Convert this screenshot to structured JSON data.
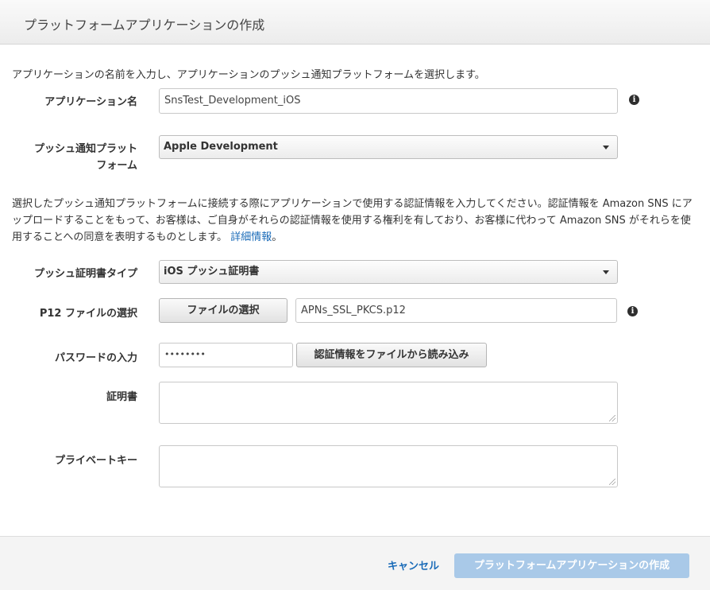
{
  "dialog": {
    "title": "プラットフォームアプリケーションの作成",
    "intro": "アプリケーションの名前を入力し、アプリケーションのプッシュ通知プラットフォームを選択します。"
  },
  "app_name": {
    "label": "アプリケーション名",
    "value": "SnsTest_Development_iOS"
  },
  "platform": {
    "label_line1": "プッシュ通知プラット",
    "label_line2": "フォーム",
    "selected": "Apple Development"
  },
  "description": {
    "text": "選択したプッシュ通知プラットフォームに接続する際にアプリケーションで使用する認証情報を入力してください。認証情報を Amazon SNS にアップロードすることをもって、お客様は、ご自身がそれらの認証情報を使用する権利を有しており、お客様に代わって Amazon SNS がそれらを使用することへの同意を表明するものとします。",
    "link": "詳細情報",
    "suffix": "。"
  },
  "cert_type": {
    "label": "プッシュ証明書タイプ",
    "selected": "iOS プッシュ証明書"
  },
  "p12": {
    "label": "P12 ファイルの選択",
    "button": "ファイルの選択",
    "filename": "APNs_SSL_PKCS.p12"
  },
  "password": {
    "label": "パスワードの入力",
    "value": "••••••••",
    "load_button": "認証情報をファイルから読み込み"
  },
  "certificate": {
    "label": "証明書"
  },
  "private_key": {
    "label": "プライベートキー"
  },
  "footer": {
    "cancel": "キャンセル",
    "create": "プラットフォームアプリケーションの作成"
  },
  "info_glyph": "i",
  "colors": {
    "link": "#1a6bb8",
    "primary_disabled": "#a9c9e8"
  }
}
